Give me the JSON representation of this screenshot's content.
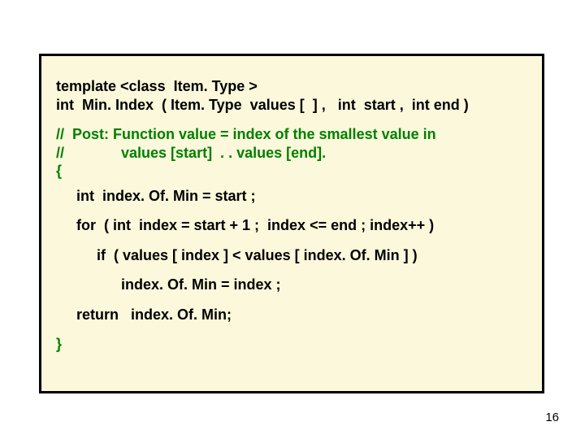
{
  "code": {
    "l1": "template <class  Item. Type >",
    "l2": "int  Min. Index  ( Item. Type  values [  ] ,   int  start ,  int end )",
    "l3": "//  Post: Function value = index of the smallest value in",
    "l4": "//              values [start]  . . values [end].",
    "l5": "{",
    "l6": "     int  index. Of. Min = start ;",
    "l7": "     for  ( int  index = start + 1 ;  index <= end ; index++ )",
    "l8": "          if  ( values [ index ] < values [ index. Of. Min ] )",
    "l9": "                index. Of. Min = index ;",
    "l10": "     return   index. Of. Min;",
    "l11": "}"
  },
  "page_number": "16"
}
